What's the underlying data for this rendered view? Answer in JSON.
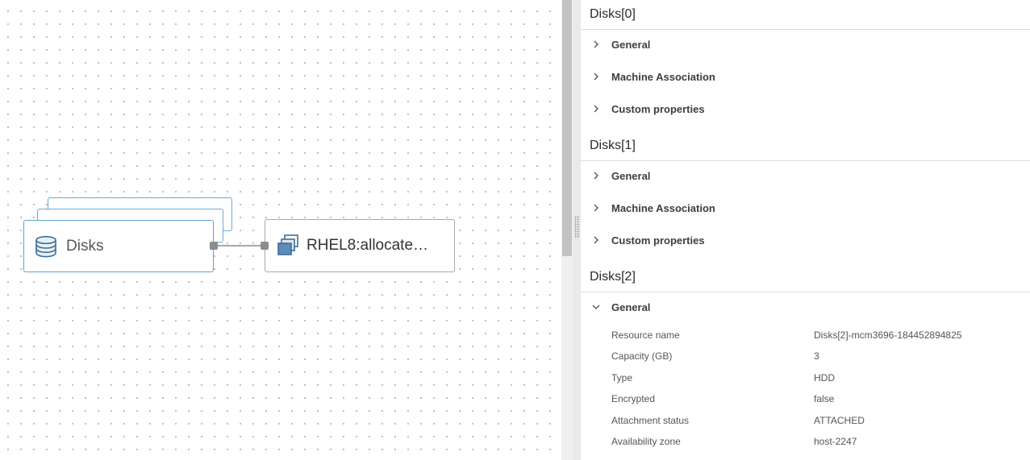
{
  "canvas": {
    "nodes": {
      "disks": {
        "label": "Disks",
        "icon": "database-icon"
      },
      "rhel": {
        "label": "RHEL8:allocate…",
        "icon": "vm-stack-icon"
      }
    },
    "colors": {
      "disk_border": "#5fa1cf",
      "vm_border": "#a9a9a9",
      "icon_blue": "#3d6d95",
      "connector": "#8c8c8c"
    }
  },
  "panel": {
    "sections": [
      {
        "title": "Disks[0]",
        "groups": [
          {
            "label": "General",
            "expanded": false
          },
          {
            "label": "Machine Association",
            "expanded": false
          },
          {
            "label": "Custom properties",
            "expanded": false
          }
        ]
      },
      {
        "title": "Disks[1]",
        "groups": [
          {
            "label": "General",
            "expanded": false
          },
          {
            "label": "Machine Association",
            "expanded": false
          },
          {
            "label": "Custom properties",
            "expanded": false
          }
        ]
      },
      {
        "title": "Disks[2]",
        "groups": [
          {
            "label": "General",
            "expanded": true
          }
        ],
        "properties": [
          {
            "key": "Resource name",
            "value": "Disks[2]-mcm3696-184452894825"
          },
          {
            "key": "Capacity (GB)",
            "value": "3"
          },
          {
            "key": "Type",
            "value": "HDD"
          },
          {
            "key": "Encrypted",
            "value": "false"
          },
          {
            "key": "Attachment status",
            "value": "ATTACHED"
          },
          {
            "key": "Availability zone",
            "value": "host-2247"
          }
        ]
      }
    ]
  }
}
